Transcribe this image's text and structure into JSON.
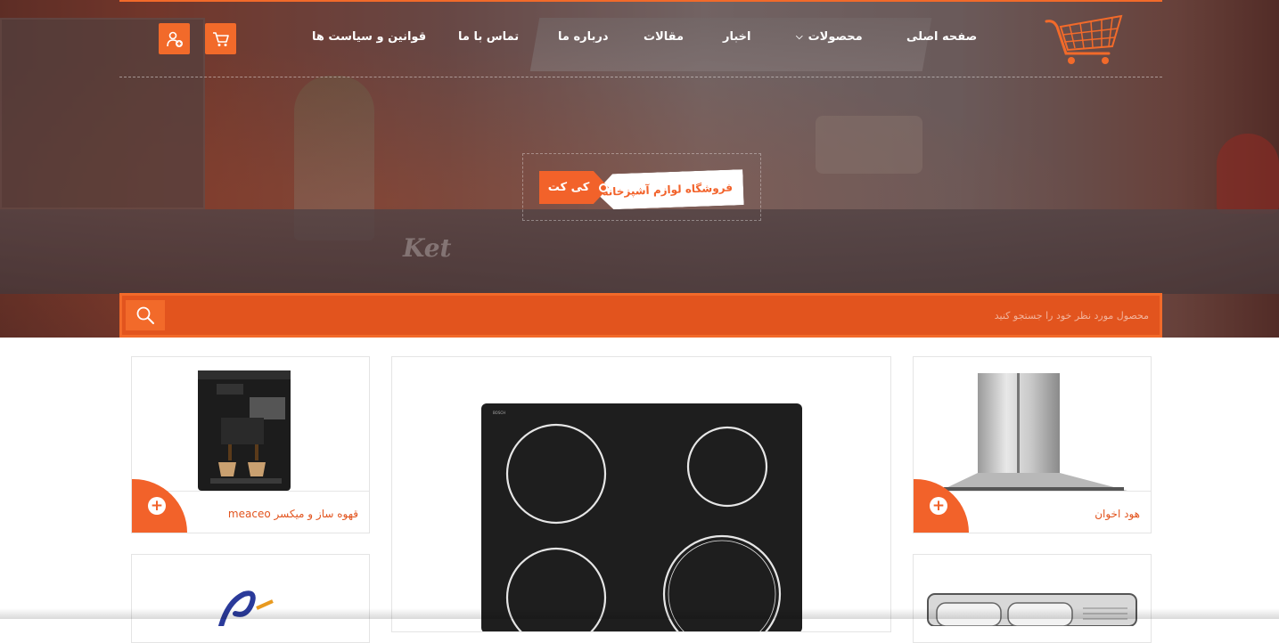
{
  "nav": {
    "items": [
      {
        "label": "صفحه اصلی"
      },
      {
        "label": "محصولات",
        "has_dropdown": true
      },
      {
        "label": "اخبار"
      },
      {
        "label": "مقالات"
      },
      {
        "label": "درباره ما"
      },
      {
        "label": "تماس با ما"
      },
      {
        "label": "قوانین و سیاست ها"
      }
    ],
    "cart_icon": "cart-icon",
    "user_icon": "add-user-icon"
  },
  "hero": {
    "badge_brand": "کی کت",
    "badge_tagline": "فروشگاه لوازم آشپزخانه",
    "watermark": "Ket"
  },
  "search": {
    "placeholder": "محصول مورد نظر خود را جستجو کنید"
  },
  "products": [
    {
      "title": "هود اخوان"
    },
    {
      "title": ""
    },
    {
      "title": "قهوه ساز و میکسر meaceo"
    },
    {
      "title": ""
    },
    {
      "title": ""
    }
  ],
  "colors": {
    "accent": "#f26a2a",
    "accent_dark": "#e2541e",
    "border": "#e4e4e4"
  }
}
